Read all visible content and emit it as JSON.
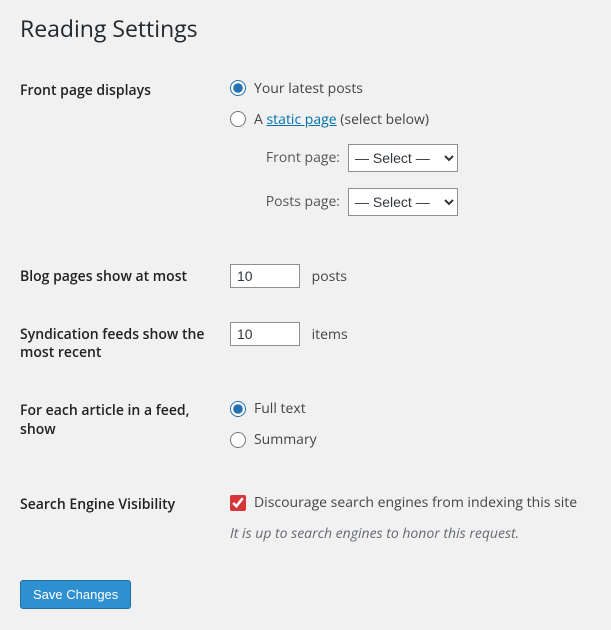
{
  "title": "Reading Settings",
  "front_page": {
    "heading": "Front page displays",
    "option_latest": "Your latest posts",
    "option_static_prefix": "A ",
    "option_static_link": "static page",
    "option_static_suffix": " (select below)",
    "front_page_label": "Front page:",
    "posts_page_label": "Posts page:",
    "select_placeholder": "— Select —",
    "selected": "latest"
  },
  "blog_pages": {
    "heading": "Blog pages show at most",
    "value": "10",
    "unit": "posts"
  },
  "syndication": {
    "heading": "Syndication feeds show the most recent",
    "value": "10",
    "unit": "items"
  },
  "feed_article": {
    "heading": "For each article in a feed, show",
    "option_full": "Full text",
    "option_summary": "Summary",
    "selected": "full"
  },
  "search_visibility": {
    "heading": "Search Engine Visibility",
    "checkbox_label": "Discourage search engines from indexing this site",
    "note": "It is up to search engines to honor this request.",
    "checked": true
  },
  "save_button": "Save Changes"
}
